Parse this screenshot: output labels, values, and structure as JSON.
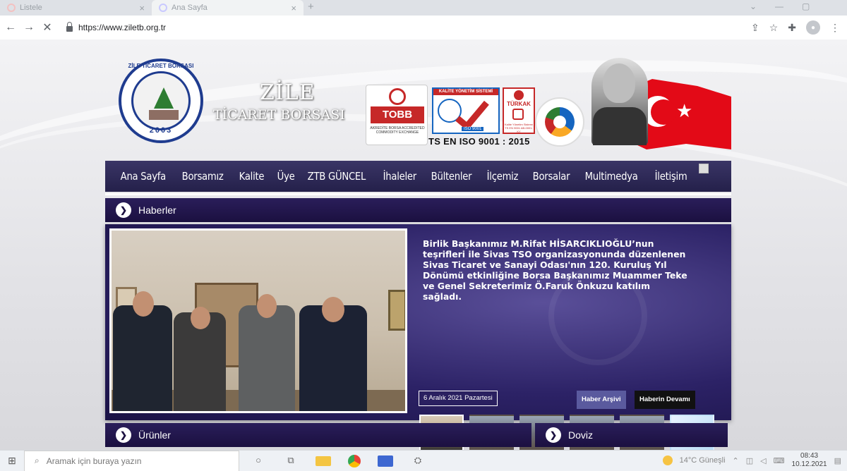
{
  "browser": {
    "tabs": [
      {
        "label": "Listele",
        "close": "×"
      },
      {
        "label": "Ana Sayfa",
        "close": "×"
      }
    ],
    "new_tab": "+",
    "url": "https://www.ziletb.org.tr",
    "icons": [
      "back-icon",
      "forward-icon",
      "stop-icon",
      "lock-icon",
      "share-icon",
      "star-icon",
      "extensions-icon",
      "profile-icon",
      "menu-icon"
    ]
  },
  "header": {
    "seal_text": "ZİLE TİCARET BORSASI",
    "seal_year": "2003",
    "brand_line1": "ZİLE",
    "brand_line2": "TİCARET BORSASI",
    "tobb_label": "TOBB",
    "tobb_sub": "AKREDİTE BORSA ACCREDITED COMMODITY EXCHANGE",
    "iso_header": "KALİTE YÖNETİM SİSTEMİ",
    "iso_badge": "ISO 9001",
    "turkak_label": "TÜRKAK",
    "turkak_foot": "Kalite Yönetim Sistemi TS EN 9001 AB-0001-KY",
    "cert_caption": "TS EN ISO 9001 : 2015"
  },
  "nav": {
    "items": [
      "Ana Sayfa",
      "Borsamız",
      "Kalite",
      "Üye",
      "ZTB GÜNCEL",
      "İhaleler",
      "Bültenler",
      "İlçemiz",
      "Borsalar",
      "Multimedya",
      "İletişim"
    ]
  },
  "sections": {
    "haberler": "Haberler",
    "urunler": "Ürünler",
    "doviz": "Doviz"
  },
  "news": {
    "headline": "Birlik Başkanımız M.Rifat HİSARCIKLIOĞLU’nun teşrifleri ile Sivas TSO organizasyonunda düzenlenen Sivas Ticaret ve Sanayi Odası'nın 120. Kuruluş Yıl Dönümü etkinliğine Borsa Başkanımız Muammer Teke ve Genel Sekreterimiz Ö.Faruk Önkuzu katılım sağladı.",
    "date": "6 Aralık 2021 Pazartesi",
    "archive_button": "Haber Arşivi",
    "more_button": "Haberin Devamı",
    "thumbnail_count": 6,
    "active_thumbnail": 1
  },
  "taskbar": {
    "search_placeholder": "Aramak için buraya yazın",
    "weather": "14°C  Güneşli",
    "time": "08:43",
    "date": "10.12.2021"
  }
}
